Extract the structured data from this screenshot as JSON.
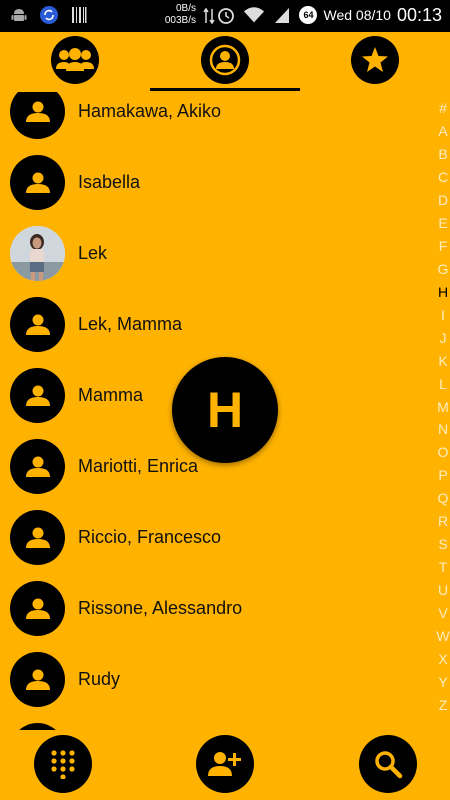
{
  "status_bar": {
    "rate_up": "0B/s",
    "rate_down": "003B/s",
    "battery_level": "64",
    "date": "Wed 08/10",
    "time": "00:13",
    "icons": [
      "android-debug-icon",
      "sync-icon",
      "barcode-icon",
      "data-transfer-icon",
      "alarm-icon",
      "wifi-icon",
      "signal-icon"
    ]
  },
  "tabs": [
    {
      "name": "groups",
      "icon": "groups-icon"
    },
    {
      "name": "contacts",
      "icon": "person-icon",
      "selected": true
    },
    {
      "name": "favorites",
      "icon": "star-icon"
    }
  ],
  "contacts": [
    {
      "name": "Hamakawa, Akiko",
      "avatar": "person-icon"
    },
    {
      "name": "Isabella",
      "avatar": "person-icon"
    },
    {
      "name": "Lek",
      "avatar": "photo"
    },
    {
      "name": "Lek, Mamma",
      "avatar": "person-icon"
    },
    {
      "name": "Mamma",
      "avatar": "person-icon"
    },
    {
      "name": "Mariotti, Enrica",
      "avatar": "person-icon"
    },
    {
      "name": "Riccio, Francesco",
      "avatar": "person-icon"
    },
    {
      "name": "Rissone, Alessandro",
      "avatar": "person-icon"
    },
    {
      "name": "Rudy",
      "avatar": "person-icon"
    }
  ],
  "index": {
    "letters": [
      "#",
      "A",
      "B",
      "C",
      "D",
      "E",
      "F",
      "G",
      "H",
      "I",
      "J",
      "K",
      "L",
      "M",
      "N",
      "O",
      "P",
      "Q",
      "R",
      "S",
      "T",
      "U",
      "V",
      "W",
      "X",
      "Y",
      "Z"
    ],
    "active": "H"
  },
  "scroll_letter": "H",
  "bottom_actions": [
    {
      "name": "dialpad",
      "icon": "dialpad-icon"
    },
    {
      "name": "add-contact",
      "icon": "add-person-icon"
    },
    {
      "name": "search",
      "icon": "search-icon"
    }
  ],
  "colors": {
    "accent": "#FFB300",
    "dark": "#000000"
  }
}
